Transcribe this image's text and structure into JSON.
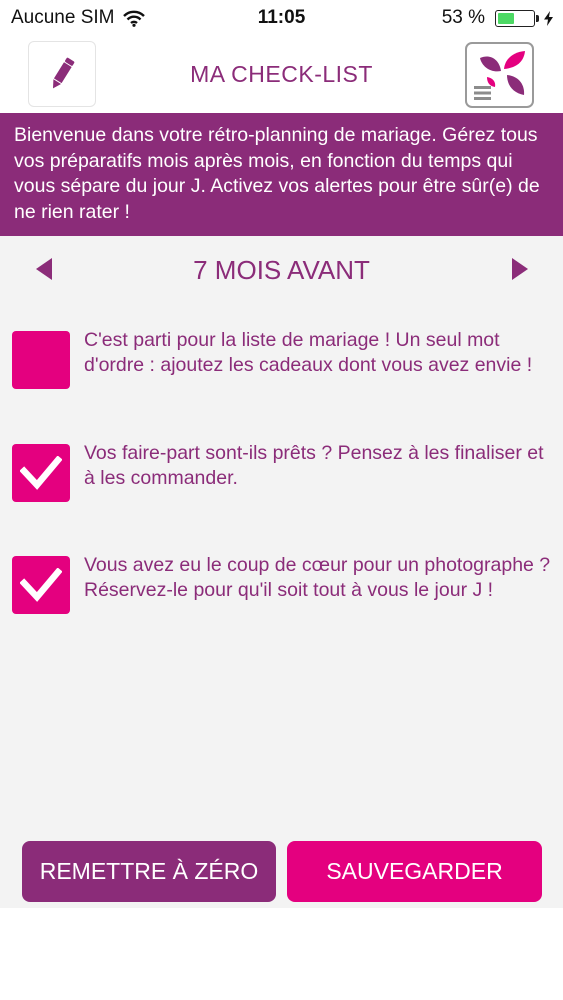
{
  "status_bar": {
    "carrier": "Aucune SIM",
    "time": "11:05",
    "battery_percent": "53 %",
    "battery_level": 0.53,
    "battery_color": "#4cd964"
  },
  "header": {
    "title": "MA CHECK-LIST",
    "edit_icon": "pencil-icon",
    "menu_icon": "leaf-logo-menu-icon"
  },
  "intro": {
    "text": "Bienvenue dans votre rétro-planning de mariage. Gérez tous vos préparatifs mois après mois, en fonction du temps qui vous sépare du jour J. Activez vos alertes pour être sûr(e) de ne rien rater !"
  },
  "nav": {
    "month_label": "7 MOIS AVANT",
    "prev_icon": "triangle-left-icon",
    "next_icon": "triangle-right-icon"
  },
  "items": [
    {
      "text": "C'est parti pour la liste de mariage ! Un seul mot d'ordre : ajoutez les cadeaux dont vous avez envie !",
      "checked": false
    },
    {
      "text": "Vos faire-part sont-ils prêts ? Pensez à les finaliser et à les commander.",
      "checked": true
    },
    {
      "text": "Vous avez eu le coup de cœur pour un photographe ? Réservez-le pour qu'il soit tout à vous le jour J !",
      "checked": true
    }
  ],
  "buttons": {
    "reset_label": "REMETTRE À ZÉRO",
    "save_label": "SAUVEGARDER"
  },
  "colors": {
    "purple": "#8b2c79",
    "magenta": "#e4007f",
    "background": "#f3f3f3"
  }
}
